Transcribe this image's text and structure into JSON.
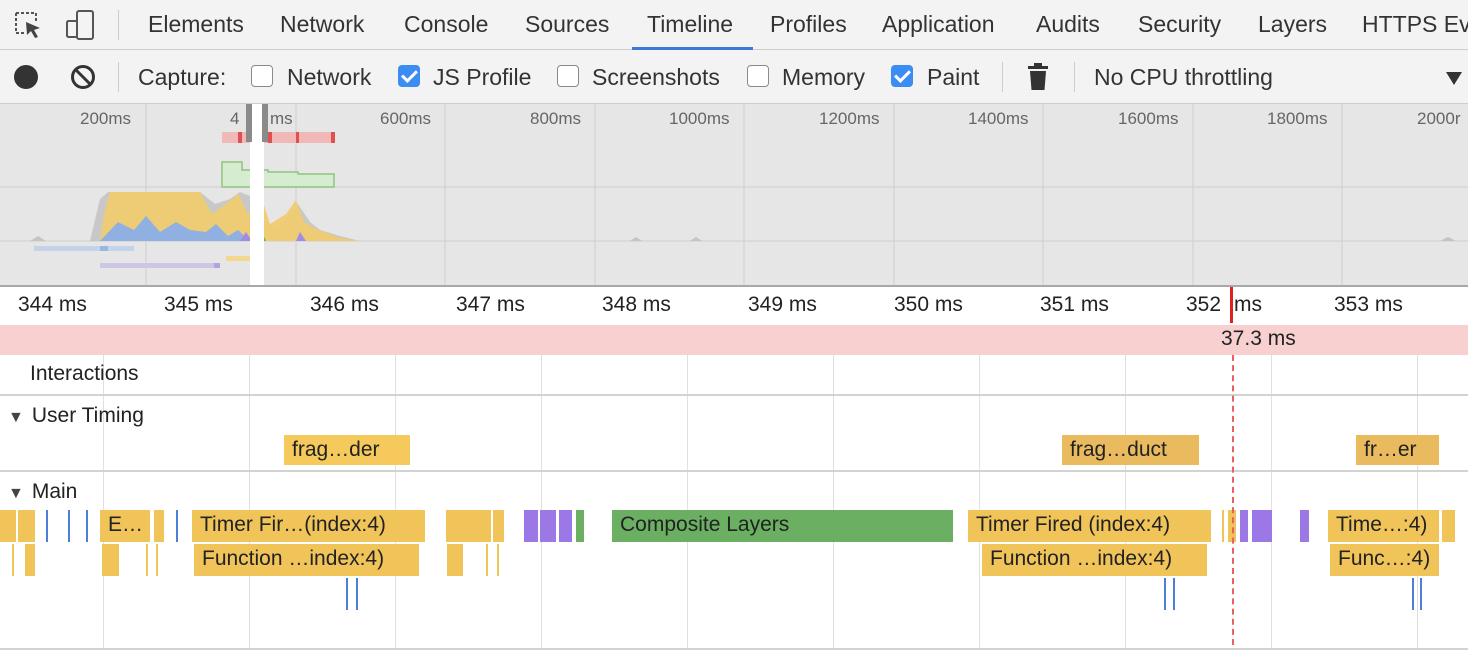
{
  "tabs": {
    "elements": "Elements",
    "network": "Network",
    "console": "Console",
    "sources": "Sources",
    "timeline": "Timeline",
    "profiles": "Profiles",
    "application": "Application",
    "audits": "Audits",
    "security": "Security",
    "layers": "Layers",
    "https": "HTTPS Ev",
    "active": "Timeline"
  },
  "toolbar": {
    "capture_label": "Capture:",
    "network_label": "Network",
    "network_checked": false,
    "js_profile_label": "JS Profile",
    "js_profile_checked": true,
    "screenshots_label": "Screenshots",
    "screenshots_checked": false,
    "memory_label": "Memory",
    "memory_checked": false,
    "paint_label": "Paint",
    "paint_checked": true,
    "throttling": "No CPU throttling"
  },
  "overview": {
    "ticks": [
      "200ms",
      "4",
      "ms",
      "600ms",
      "800ms",
      "1000ms",
      "1200ms",
      "1400ms",
      "1600ms",
      "1800ms",
      "2000r"
    ]
  },
  "ruler": {
    "ticks": [
      "344 ms",
      "345 ms",
      "346 ms",
      "347 ms",
      "348 ms",
      "349 ms",
      "350 ms",
      "351 ms",
      "352",
      "ms",
      "353 ms"
    ]
  },
  "frame": {
    "duration": "37.3 ms"
  },
  "tracks": {
    "interactions": "Interactions",
    "user_timing": "User Timing",
    "main": "Main"
  },
  "user_timing_marks": [
    "frag…der",
    "frag…duct",
    "fr…er"
  ],
  "main_events": {
    "row1": [
      "E…",
      "Timer Fir…(index:4)",
      "Composite Layers",
      "Timer Fired (index:4)",
      "Time…:4)"
    ],
    "row2": [
      "Function …index:4)",
      "Function …index:4)",
      "Func…:4)"
    ]
  },
  "colors": {
    "scripting": "#f1c45a",
    "rendering": "#9b78e6",
    "painting": "#6bb062",
    "frame": "#f8d0d0",
    "accent": "#3879d9",
    "current_time": "#e02020"
  }
}
